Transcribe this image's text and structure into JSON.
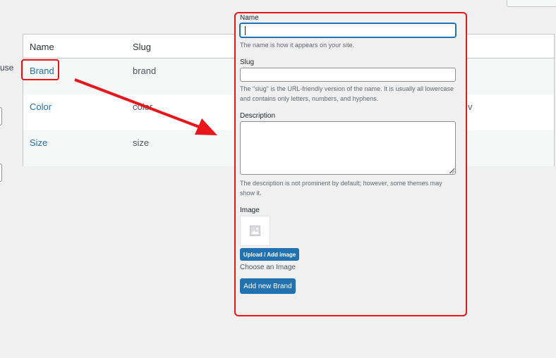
{
  "left": {
    "partial_text": "use"
  },
  "table": {
    "headers": {
      "name": "Name",
      "slug": "Slug"
    },
    "rows": [
      {
        "name": "Brand",
        "slug": "brand",
        "extra": ""
      },
      {
        "name": "Color",
        "slug": "color",
        "extra": "v"
      },
      {
        "name": "Size",
        "slug": "size",
        "extra": ""
      }
    ]
  },
  "form": {
    "name_label": "Name",
    "name_value": "",
    "name_help": "The name is how it appears on your site.",
    "slug_label": "Slug",
    "slug_value": "",
    "slug_help": "The \"slug\" is the URL-friendly version of the name. It is usually all lowercase and contains only letters, numbers, and hyphens.",
    "description_label": "Description",
    "description_help": "The description is not prominent by default; however, some themes may show it.",
    "image_label": "Image",
    "upload_button": "Upload / Add image",
    "choose_text": "Choose an Image",
    "submit_button": "Add new Brand"
  },
  "colors": {
    "accent": "#2271b1",
    "highlight": "#e8151b",
    "background": "#f0f0f1"
  },
  "icons": {
    "image_placeholder": "image-placeholder-icon",
    "annotation_arrow": "arrow-icon"
  }
}
